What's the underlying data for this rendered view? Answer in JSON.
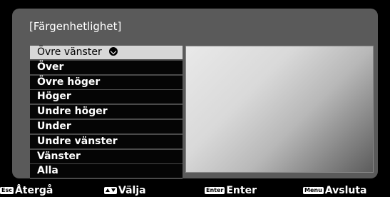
{
  "dialog": {
    "title": "[Färgenhetlighet]"
  },
  "positions": [
    {
      "label": "Övre vänster",
      "selected": true
    },
    {
      "label": "Över",
      "selected": false
    },
    {
      "label": "Övre höger",
      "selected": false
    },
    {
      "label": "Höger",
      "selected": false
    },
    {
      "label": "Undre höger",
      "selected": false
    },
    {
      "label": "Under",
      "selected": false
    },
    {
      "label": "Undre vänster",
      "selected": false
    },
    {
      "label": "Vänster",
      "selected": false
    },
    {
      "label": "Alla",
      "selected": false
    }
  ],
  "footer": {
    "back": {
      "key": "Esc",
      "label": "Återgå"
    },
    "select": {
      "key": "arrows-up-down",
      "label": "Välja"
    },
    "enter": {
      "key": "Enter",
      "label": "Enter"
    },
    "exit": {
      "key": "Menu",
      "label": "Avsluta"
    }
  },
  "colors": {
    "selected_bg": "#d7d7d7",
    "item_bg": "#050505",
    "panel_bg": "#5a5a5a"
  }
}
